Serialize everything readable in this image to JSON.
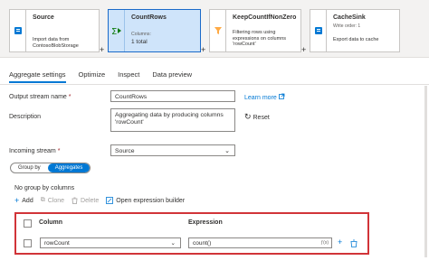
{
  "pipeline": {
    "nodes": [
      {
        "title": "Source",
        "description": "Import data from ContosoBlobStorage"
      },
      {
        "title": "CountRows",
        "columns_label": "Columns:",
        "columns_value": "1 total"
      },
      {
        "title": "KeepCountIfNonZero",
        "description": "Filtering rows using expressions on columns 'rowCount'"
      },
      {
        "title": "CacheSink",
        "order_label": "Write order: 1",
        "description": "Export data to cache"
      }
    ],
    "add_symbol": "+"
  },
  "tabs": [
    "Aggregate settings",
    "Optimize",
    "Inspect",
    "Data preview"
  ],
  "form": {
    "output_stream_label": "Output stream name",
    "output_stream_value": "CountRows",
    "learn_more": "Learn more",
    "description_label": "Description",
    "description_value": "Aggregating data by producing columns 'rowCount'",
    "reset_label": "Reset",
    "incoming_stream_label": "Incoming stream",
    "incoming_stream_value": "Source",
    "required_mark": "*"
  },
  "pivot": {
    "group_by": "Group by",
    "aggregates": "Aggregates"
  },
  "aggregates": {
    "empty_hint": "No group by columns",
    "toolbar": {
      "add": "Add",
      "clone": "Clone",
      "delete": "Delete",
      "expression_builder": "Open expression builder"
    },
    "header": {
      "column": "Column",
      "expression": "Expression"
    },
    "rows": [
      {
        "column": "rowCount",
        "expression": "count()"
      }
    ],
    "expr_marker": "ƒ(x)"
  },
  "colors": {
    "accent": "#0078d4",
    "highlight": "#d13438",
    "selected_node": "#cfe4fa"
  }
}
